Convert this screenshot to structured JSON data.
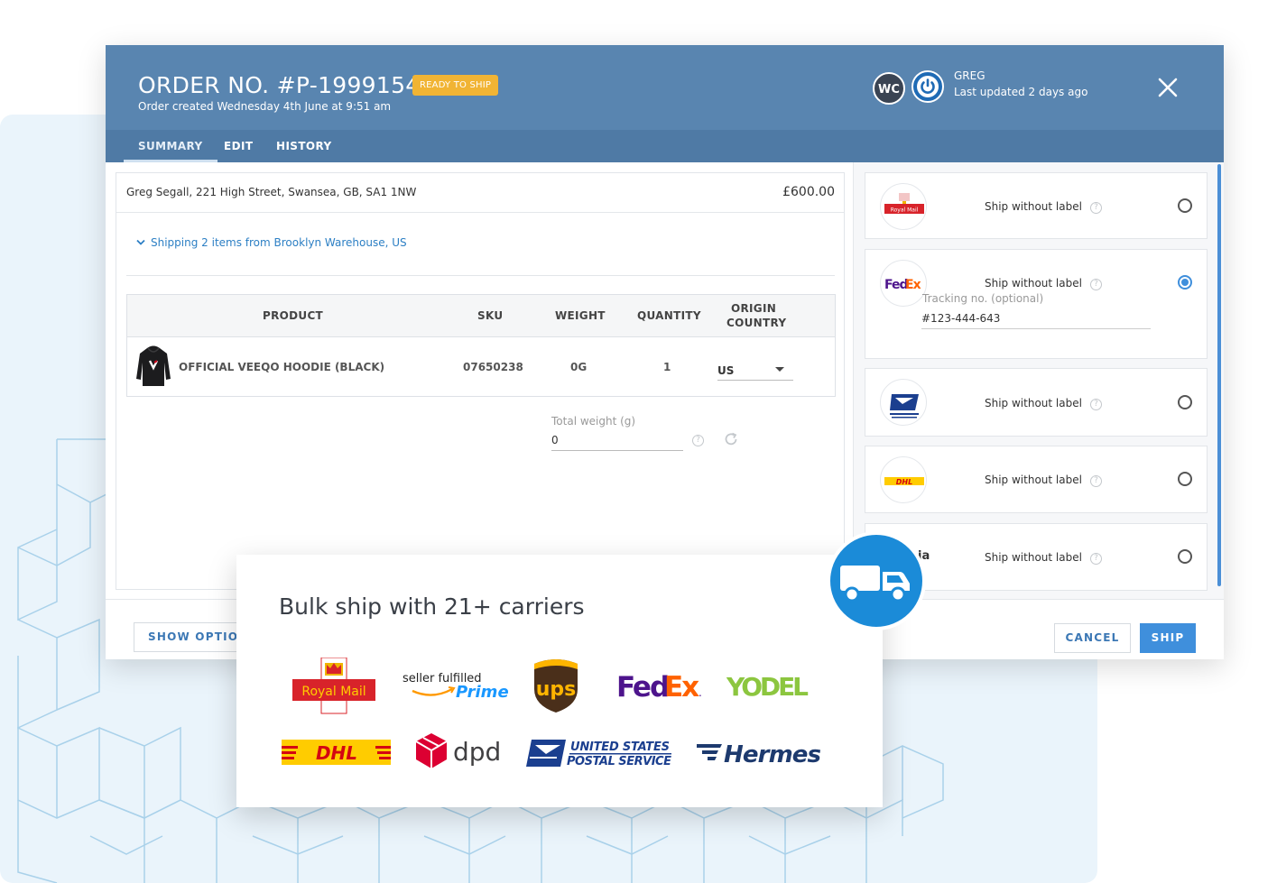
{
  "order": {
    "title": "ORDER NO. #P-19991542",
    "status": "READY TO SHIP",
    "created": "Order created Wednesday 4th June at 9:51 am"
  },
  "user": {
    "initials": "WC",
    "name": "GREG",
    "updated": "Last updated 2 days ago"
  },
  "tabs": [
    {
      "label": "SUMMARY",
      "active": true
    },
    {
      "label": "EDIT",
      "active": false
    },
    {
      "label": "HISTORY",
      "active": false
    }
  ],
  "summary": {
    "address": "Greg Segall, 221 High Street, Swansea, GB, SA1 1NW",
    "price": "£600.00",
    "shipping_toggle": "Shipping 2 items from Brooklyn Warehouse, US"
  },
  "table": {
    "headers": {
      "product": "PRODUCT",
      "sku": "SKU",
      "weight": "WEIGHT",
      "quantity": "QUANTITY",
      "origin_line1": "ORIGIN",
      "origin_line2": "COUNTRY"
    },
    "rows": [
      {
        "product": "OFFICIAL VEEQO HOODIE (BLACK)",
        "sku": "07650238",
        "weight": "0G",
        "quantity": "1",
        "origin": "US"
      }
    ]
  },
  "total_weight": {
    "label": "Total weight (g)",
    "value": "0"
  },
  "carriers": [
    {
      "name": "Royal Mail",
      "label": "Ship without label",
      "selected": false
    },
    {
      "name": "FedEx",
      "label": "Ship without label",
      "selected": true,
      "tracking_label": "Tracking no. (optional)",
      "tracking_value": "#123-444-643"
    },
    {
      "name": "USPS",
      "label": "Ship without label",
      "selected": false
    },
    {
      "name": "DHL",
      "label": "Ship without label",
      "selected": false
    },
    {
      "name": "ia",
      "label": "Ship without label",
      "selected": false
    }
  ],
  "footer": {
    "show_options": "SHOW OPTIONS",
    "cancel": "CANCEL",
    "ship": "SHIP"
  },
  "bulk": {
    "title": "Bulk ship with 21+ carriers",
    "logos": {
      "royal_mail": "Royal Mail",
      "prime_line1": "seller fulfilled",
      "prime_line2": "Prime",
      "ups": "ups",
      "fedex_fed": "Fed",
      "fedex_ex": "Ex",
      "fedex_dot": ".",
      "yodel": "YODEL",
      "dhl": "DHL",
      "dpd": "dpd",
      "usps_line1": "UNITED STATES",
      "usps_line2": "POSTAL SERVICE",
      "hermes": "Hermes"
    }
  },
  "colors": {
    "header": "#5985b0",
    "tab_bar": "#4f7aa5",
    "badge": "#f1b434",
    "accent": "#3f8fdc",
    "truck_badge": "#1b8bd8"
  },
  "icons": [
    "close-icon",
    "power-icon",
    "chevron-down-icon",
    "help-icon",
    "refresh-icon",
    "truck-icon"
  ]
}
